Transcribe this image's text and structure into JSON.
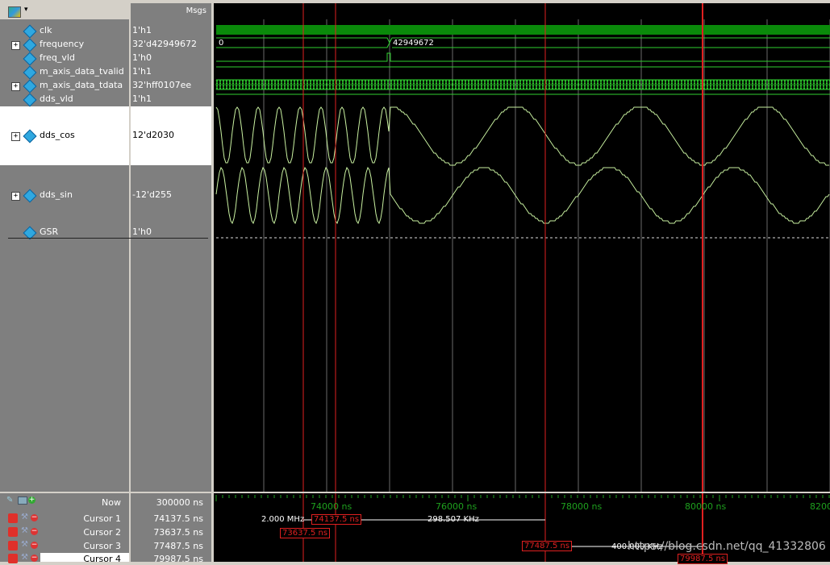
{
  "header": {
    "msgs_label": "Msgs"
  },
  "signals": [
    {
      "name": "clk",
      "value": "1'h1",
      "expandable": false
    },
    {
      "name": "frequency",
      "value": "32'd42949672",
      "expandable": true
    },
    {
      "name": "freq_vld",
      "value": "1'h0",
      "expandable": false
    },
    {
      "name": "m_axis_data_tvalid",
      "value": "1'h1",
      "expandable": false
    },
    {
      "name": "m_axis_data_tdata",
      "value": "32'hff0107ee",
      "expandable": true
    },
    {
      "name": "dds_vld",
      "value": "1'h1",
      "expandable": false
    },
    {
      "name": "dds_cos",
      "value": "12'd2030",
      "expandable": true
    },
    {
      "name": "dds_sin",
      "value": "-12'd255",
      "expandable": true
    },
    {
      "name": "GSR",
      "value": "1'h0",
      "expandable": false
    }
  ],
  "bus_values": {
    "frequency_before": "0",
    "frequency_after": "42949672"
  },
  "cursor_pane": {
    "now_label": "Now",
    "now_value": "300000 ns",
    "cursors": [
      {
        "label": "Cursor 1",
        "value": "74137.5 ns"
      },
      {
        "label": "Cursor 2",
        "value": "73637.5 ns"
      },
      {
        "label": "Cursor 3",
        "value": "77487.5 ns"
      },
      {
        "label": "Cursor 4",
        "value": "79987.5 ns"
      }
    ]
  },
  "timeline": {
    "ticks": [
      "74000 ns",
      "76000 ns",
      "78000 ns",
      "80000 ns",
      "8200"
    ],
    "cursor_labels": [
      "74137.5 ns",
      "73637.5 ns",
      "77487.5 ns",
      "79987.5 ns"
    ],
    "deltas": [
      "2.000 MHz",
      "298.507 KHz",
      "400.000 KHz"
    ]
  },
  "watermark": "https://blog.csdn.net/qq_41332806",
  "colors": {
    "wave": "#c8f0a0",
    "bus": "#2fd02f",
    "clk_fill": "#0a8a0a",
    "cursor": "#e02020",
    "grid": "#6a6a6a"
  }
}
